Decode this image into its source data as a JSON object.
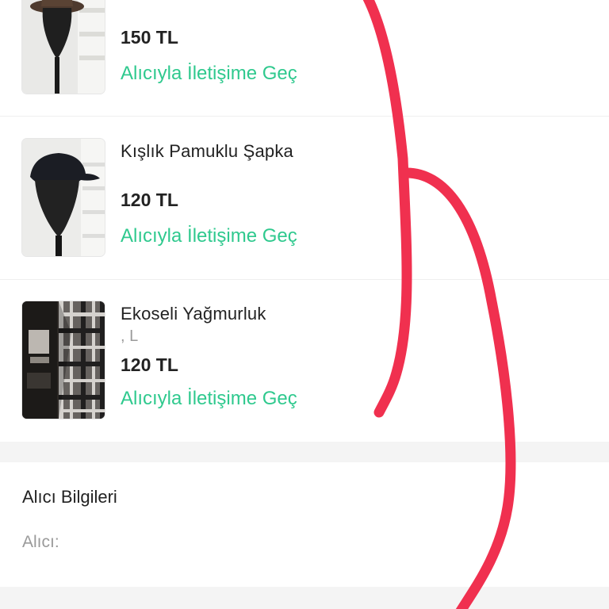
{
  "order_items": [
    {
      "thumbnail": "fedora-hat-on-mannequin",
      "name": "",
      "variant": "",
      "price": "150 TL",
      "contact_label": "Alıcıyla İletişime Geç"
    },
    {
      "thumbnail": "black-cap-on-mannequin",
      "name": "Kışlık Pamuklu Şapka",
      "variant": "",
      "price": "120 TL",
      "contact_label": "Alıcıyla İletişime Geç"
    },
    {
      "thumbnail": "plaid-raincoat",
      "name": "Ekoseli Yağmurluk",
      "variant": ", L",
      "price": "120 TL",
      "contact_label": "Alıcıyla İletişime Geç"
    }
  ],
  "buyer": {
    "title": "Alıcı Bilgileri",
    "label": "Alıcı:"
  },
  "colors": {
    "accent": "#2fc98e",
    "scribble": "#f0304f",
    "section_gap": "#f4f4f4"
  }
}
